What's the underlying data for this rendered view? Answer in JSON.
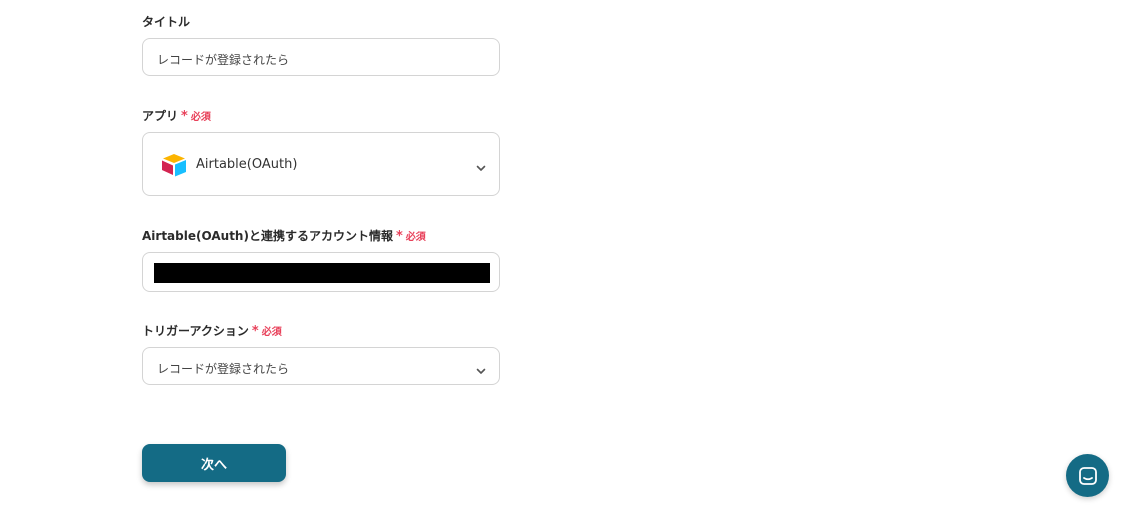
{
  "form": {
    "title": {
      "label": "タイトル",
      "value": "レコードが登録されたら"
    },
    "app": {
      "label": "アプリ",
      "required_mark": "*",
      "required_text": "必須",
      "selected_value": "Airtable(OAuth)",
      "icon": "airtable-logo"
    },
    "account": {
      "label": "Airtable(OAuth)と連携するアカウント情報",
      "required_mark": "*",
      "required_text": "必須",
      "value_redacted": true
    },
    "trigger_action": {
      "label": "トリガーアクション",
      "required_mark": "*",
      "required_text": "必須",
      "selected_value": "レコードが登録されたら"
    },
    "next_button_label": "次へ"
  },
  "chat_widget": {
    "icon": "chat-icon"
  },
  "colors": {
    "primary": "#146b85",
    "required": "#e8415a",
    "border": "#d4d4d4"
  }
}
